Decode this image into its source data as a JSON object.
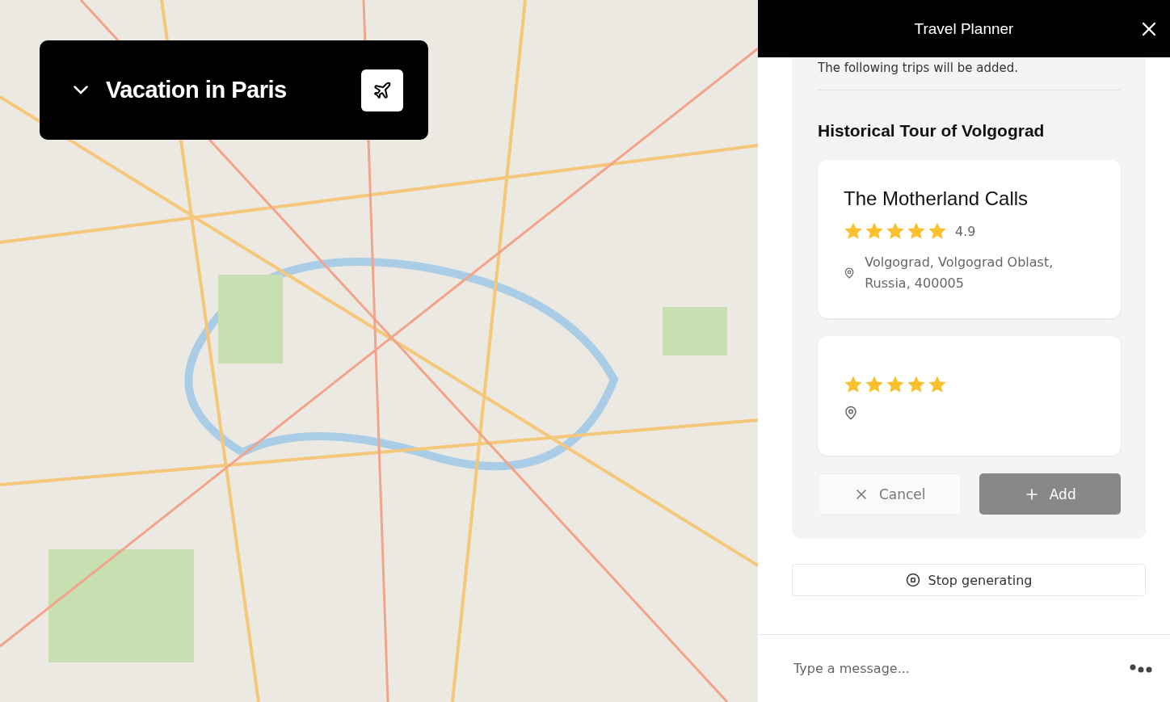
{
  "trip_header": {
    "title": "Vacation in Paris",
    "expanded": false
  },
  "panel": {
    "title": "Travel Planner"
  },
  "message": {
    "intro": "The following trips will be added.",
    "trip_title": "Historical Tour of Volgograd",
    "places": [
      {
        "name": "The Motherland Calls",
        "stars": 5,
        "rating": "4.9",
        "address": "Volgograd, Volgograd Oblast, Russia, 400005"
      },
      {
        "stars": 5
      }
    ],
    "buttons": [
      {
        "kind": "cancel",
        "label": "Cancel"
      },
      {
        "kind": "add",
        "label": "Add"
      }
    ]
  },
  "stop_button": {
    "label": "Stop generating"
  },
  "composer": {
    "placeholder": "Type a message..."
  }
}
